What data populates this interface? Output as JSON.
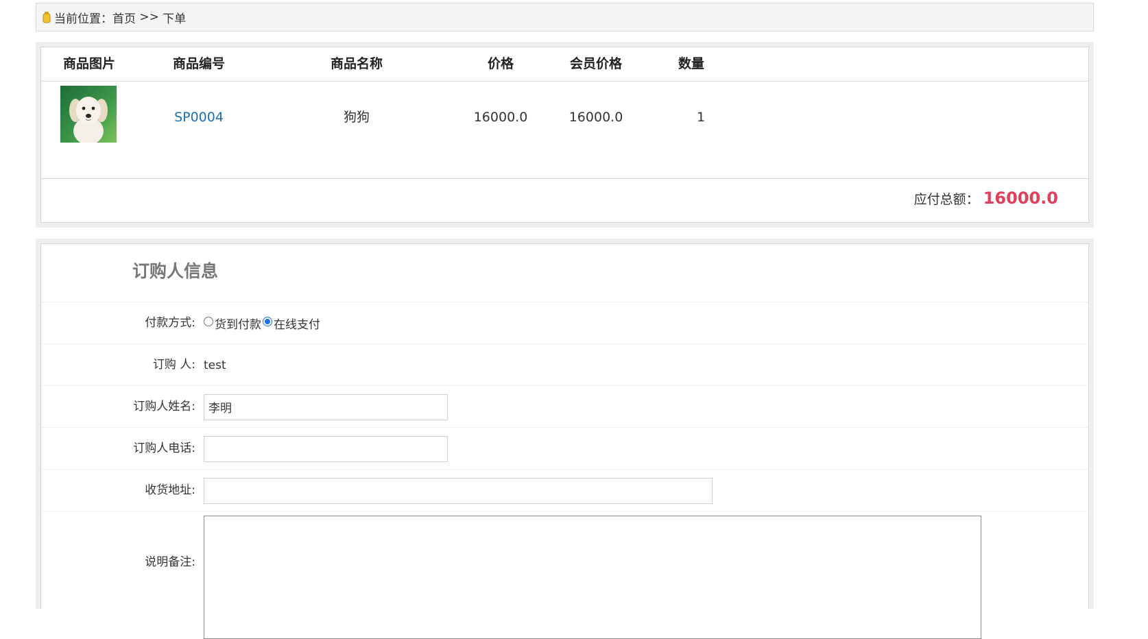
{
  "breadcrumb": {
    "prefix": "当前位置：",
    "home": "首页",
    "separator": " >> ",
    "current": "下单"
  },
  "order_table": {
    "headers": [
      "商品图片",
      "商品编号",
      "商品名称",
      "价格",
      "会员价格",
      "数量"
    ],
    "row": {
      "image_alt": "狗狗",
      "code": "SP0004",
      "name": "狗狗",
      "price": "16000.0",
      "member_price": "16000.0",
      "quantity": "1"
    },
    "total_label": "应付总额：",
    "total_value": "16000.0"
  },
  "buyer": {
    "title": "订购人信息",
    "payment_label": "付款方式:",
    "payment_options": [
      {
        "label": "货到付款",
        "checked": false
      },
      {
        "label": "在线支付",
        "checked": true
      }
    ],
    "account_label": "订购 人:",
    "account_value": "test",
    "name_label": "订购人姓名:",
    "name_value": "李明",
    "phone_label": "订购人电话:",
    "phone_value": "",
    "address_label": "收货地址:",
    "address_value": "",
    "remark_label": "说明备注:",
    "remark_value": ""
  },
  "colors": {
    "link": "#1a6fb3",
    "total": "#e0405a",
    "panel_bg": "#eeeeee"
  }
}
